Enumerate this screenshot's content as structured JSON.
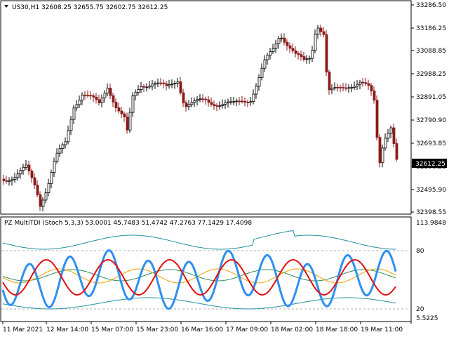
{
  "chart": {
    "symbol_line": "US30,H1  32608.25 32655.75 32602.75 32612.25",
    "price_axis": [
      "33286.50",
      "33186.25",
      "33088.85",
      "32988.25",
      "32891.05",
      "32790.90",
      "32693.85",
      "32596.25",
      "32495.90",
      "32398.55"
    ],
    "current_price": "32612.25",
    "colors": {
      "bull": "#000000",
      "bear": "#8b1a1a",
      "doji": "#2e8b57",
      "price_tag": "#000000"
    }
  },
  "indicator": {
    "title": "PZ MultiTDI (Stoch 5,3,3) 53.0001 45.7483 51.4742 47.2763 77.1429 17.4098",
    "axis": [
      "113.9848",
      "80",
      "20",
      "5.5225"
    ],
    "colors": {
      "stoch": "#2f8ff0",
      "signal": "#e01010",
      "mid": "#f0a000",
      "bands": "#1f8f9f",
      "base": "#2e8b57"
    }
  },
  "time_axis": [
    "11 Mar 2021",
    "12 Mar 14:00",
    "15 Mar 07:00",
    "15 Mar 23:00",
    "16 Mar 16:00",
    "17 Mar 09:00",
    "18 Mar 02:00",
    "18 Mar 18:00",
    "19 Mar 11:00"
  ]
}
